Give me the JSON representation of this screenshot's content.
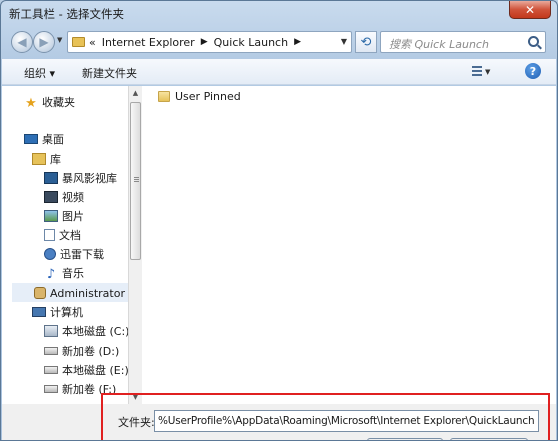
{
  "window": {
    "title": "新工具栏 - 选择文件夹",
    "close_glyph": "✕"
  },
  "navigation": {
    "back_glyph": "◀",
    "forward_glyph": "▶",
    "breadcrumb": [
      "Internet Explorer",
      "Quick Launch"
    ],
    "breadcrumb_prefix": "«",
    "search_placeholder": "搜索 Quick Launch"
  },
  "toolbar": {
    "organize_label": "组织 ▾",
    "new_folder_label": "新建文件夹",
    "help_label": "?"
  },
  "nav_pane": {
    "favorites": "收藏夹",
    "desktop": "桌面",
    "libraries": "库",
    "storm_library": "暴风影视库",
    "videos": "视频",
    "pictures": "图片",
    "documents": "文档",
    "thunder_downloads": "迅雷下载",
    "music": "音乐",
    "user": "Administrator",
    "computer": "计算机",
    "drive_c": "本地磁盘 (C:)",
    "drive_d": "新加卷 (D:)",
    "drive_e": "本地磁盘 (E:)",
    "drive_f": "新加卷 (F:)"
  },
  "content": {
    "items": [
      {
        "name": "User Pinned"
      }
    ]
  },
  "footer": {
    "folder_label": "文件夹:",
    "folder_value": "%UserProfile%\\AppData\\Roaming\\Microsoft\\Internet Explorer\\QuickLaunch"
  },
  "colors": {
    "highlight_border": "#e02020",
    "close_button": "#c2381c"
  }
}
